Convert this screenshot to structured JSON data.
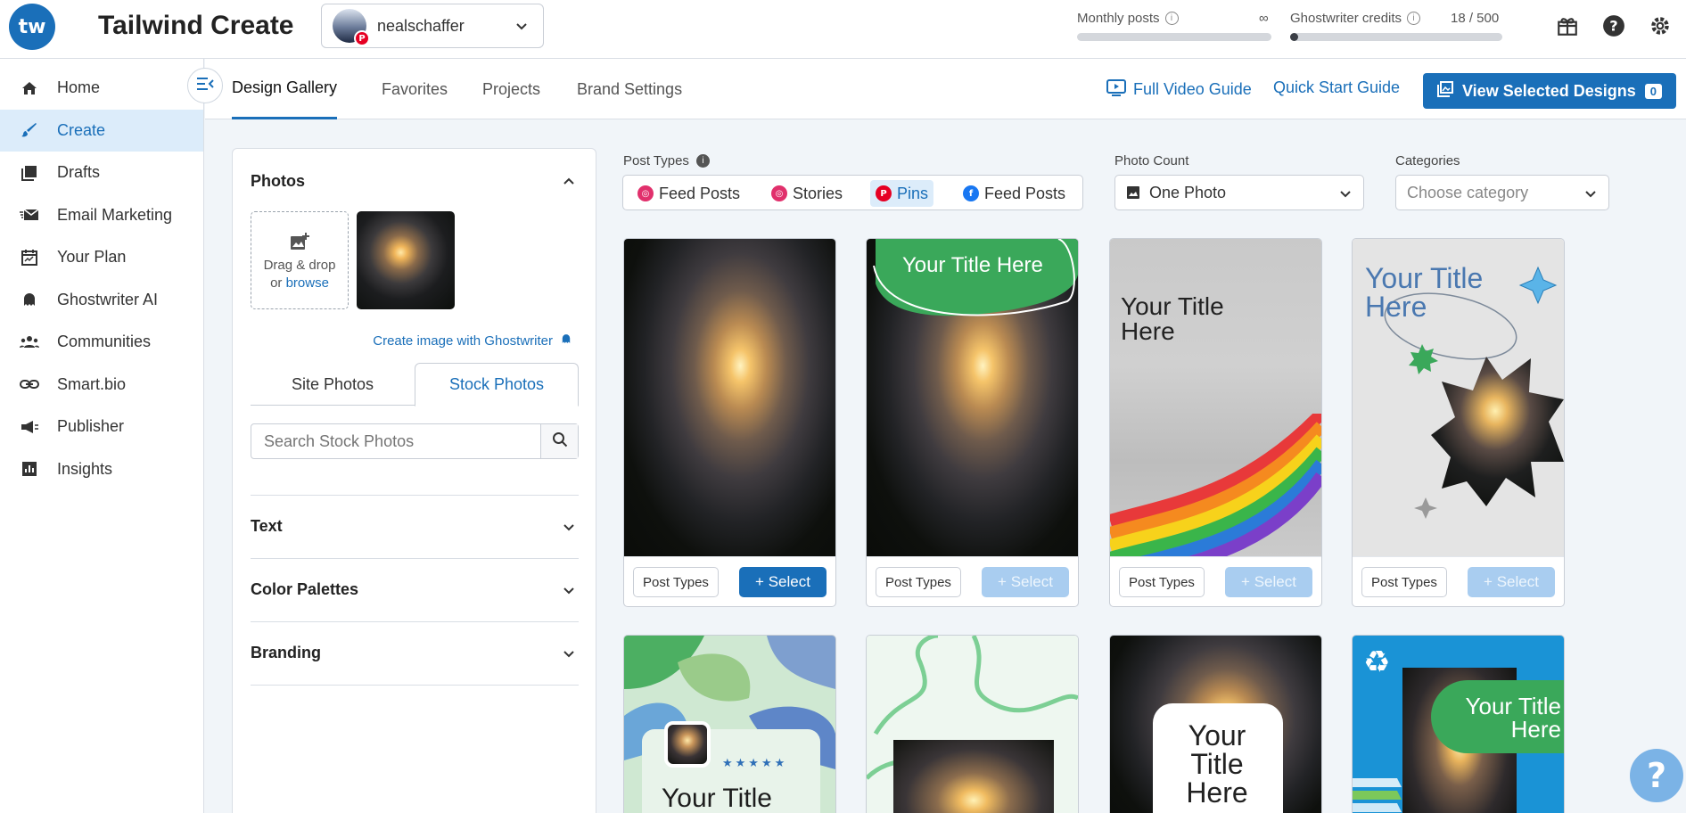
{
  "app": {
    "logo_text": "tw",
    "title": "Tailwind Create"
  },
  "account": {
    "name": "nealschaffer",
    "pin_badge": "P"
  },
  "meters": {
    "monthly": {
      "label": "Monthly posts",
      "value": "∞",
      "fill": 0.0
    },
    "ghostwriter": {
      "label": "Ghostwriter credits",
      "value": "18 / 500",
      "fill": 0.036
    }
  },
  "top_icons": [
    "gift-icon",
    "help-icon",
    "settings-icon"
  ],
  "sidebar": {
    "items": [
      {
        "label": "Home",
        "icon": "home-icon"
      },
      {
        "label": "Create",
        "icon": "brush-icon",
        "active": true
      },
      {
        "label": "Drafts",
        "icon": "drafts-icon"
      },
      {
        "label": "Email Marketing",
        "icon": "email-icon"
      },
      {
        "label": "Your Plan",
        "icon": "calendar-icon"
      },
      {
        "label": "Ghostwriter AI",
        "icon": "ghost-icon"
      },
      {
        "label": "Communities",
        "icon": "people-icon"
      },
      {
        "label": "Smart.bio",
        "icon": "link-icon"
      },
      {
        "label": "Publisher",
        "icon": "megaphone-icon"
      },
      {
        "label": "Insights",
        "icon": "chart-icon"
      }
    ]
  },
  "tabs": [
    "Design Gallery",
    "Favorites",
    "Projects",
    "Brand Settings"
  ],
  "header_links": {
    "video": "Full Video Guide",
    "quickstart": "Quick Start Guide"
  },
  "view_selected": {
    "label": "View Selected Designs",
    "count": "0"
  },
  "panel": {
    "photos": {
      "heading": "Photos",
      "drop_line1": "Drag & drop",
      "drop_or": "or",
      "drop_browse": "browse",
      "ghostwriter_link": "Create image with Ghostwriter"
    },
    "subtabs": [
      "Site Photos",
      "Stock Photos"
    ],
    "search_placeholder": "Search Stock Photos",
    "sections": [
      "Text",
      "Color Palettes",
      "Branding"
    ]
  },
  "filters": {
    "post_types_label": "Post Types",
    "post_types": [
      {
        "label": "Feed Posts",
        "network": "instagram"
      },
      {
        "label": "Stories",
        "network": "instagram"
      },
      {
        "label": "Pins",
        "network": "pinterest",
        "active": true
      },
      {
        "label": "Feed Posts",
        "network": "facebook"
      }
    ],
    "photo_count_label": "Photo Count",
    "photo_count_value": "One Photo",
    "categories_label": "Categories",
    "categories_placeholder": "Choose category"
  },
  "cards": {
    "post_types_label": "Post Types",
    "select_label": "+ Select",
    "titles": {
      "c2": "Your Title Here",
      "c3": "Your Title Here",
      "c4": "Your Title Here",
      "c5": "Your Title",
      "c7": "Your Title Here",
      "c8": "Your Title Here"
    },
    "c5_stars": "★★★★★"
  },
  "help_fab": "?",
  "colors": {
    "accent": "#1a6fb9",
    "pinterest": "#e60023",
    "instagram": "#e1306c",
    "facebook": "#1877f2",
    "green": "#3aa85a"
  }
}
